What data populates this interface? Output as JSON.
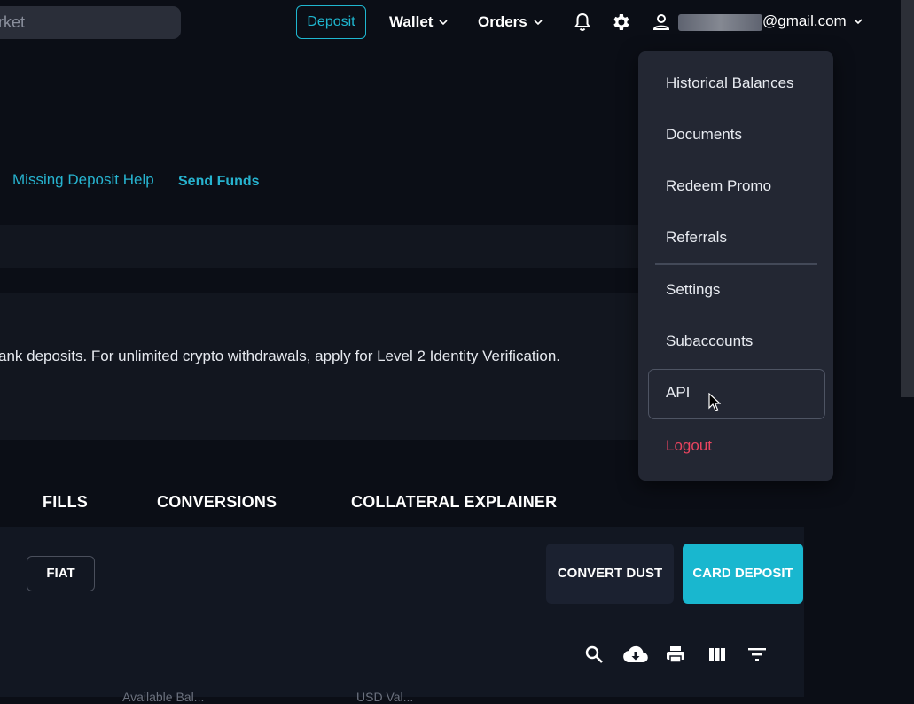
{
  "header": {
    "search_text": "arket",
    "deposit_label": "Deposit",
    "wallet_label": "Wallet",
    "orders_label": "Orders",
    "email_suffix": "@gmail.com",
    "icons": [
      "bell-icon",
      "gear-icon",
      "user-icon",
      "chevron-down-icon"
    ]
  },
  "links": {
    "missing_deposit": "Missing Deposit Help",
    "send_funds": "Send Funds"
  },
  "notice_text": "ank deposits. For unlimited crypto withdrawals, apply for Level 2 Identity Verification.",
  "tabs": [
    "FILLS",
    "CONVERSIONS",
    "COLLATERAL EXPLAINER"
  ],
  "filters": {
    "fiat_label": "FIAT"
  },
  "actions": {
    "convert_dust": "CONVERT DUST",
    "card_deposit": "CARD DEPOSIT"
  },
  "toolbar_icons": [
    "search-icon",
    "download-icon",
    "print-icon",
    "columns-icon",
    "filter-icon"
  ],
  "column_headers": [
    "Available Bal...",
    "USD Val..."
  ],
  "dropdown": {
    "items": [
      "Historical Balances",
      "Documents",
      "Redeem Promo",
      "Referrals",
      "Settings",
      "Subaccounts",
      "API",
      "Logout"
    ]
  },
  "colors": {
    "accent": "#1fb6cf",
    "background": "#0b0e16",
    "menu_bg": "#232733",
    "logout": "#e8445f"
  }
}
